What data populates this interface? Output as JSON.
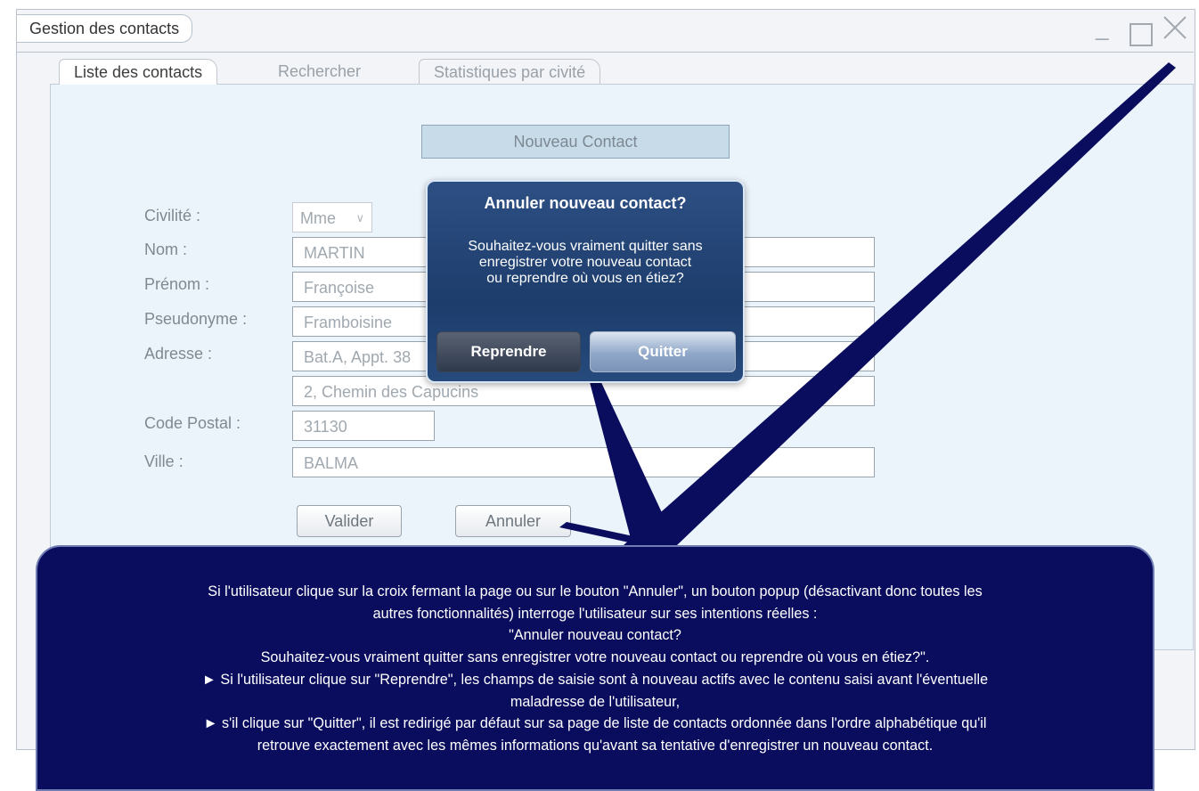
{
  "window": {
    "title": "Gestion des contacts",
    "controls": [
      "minimize-icon",
      "maximize-icon",
      "close-icon"
    ]
  },
  "tabs": [
    {
      "label": "Liste des contacts",
      "active": true
    },
    {
      "label": "Rechercher",
      "active": false
    },
    {
      "label": "Statistiques par civité",
      "active": false
    }
  ],
  "form": {
    "new_contact_button": "Nouveau Contact",
    "labels": {
      "civilite": "Civilité :",
      "nom": "Nom :",
      "prenom": "Prénom :",
      "pseudonyme": "Pseudonyme :",
      "adresse": "Adresse :",
      "code_postal": "Code Postal :",
      "ville": "Ville :"
    },
    "values": {
      "civilite": "Mme",
      "nom": "MARTIN",
      "prenom": "Françoise",
      "pseudonyme": "Framboisine",
      "adresse1": "Bat.A, Appt. 38",
      "adresse2": "2, Chemin des Capucins",
      "code_postal": "31130",
      "ville": "BALMA"
    },
    "valider_label": "Valider",
    "annuler_label": "Annuler"
  },
  "dialog": {
    "title": "Annuler nouveau contact?",
    "message_lines": [
      "Souhaitez-vous vraiment quitter sans",
      "enregistrer votre nouveau contact",
      "ou reprendre où vous en étiez?"
    ],
    "reprendre_label": "Reprendre",
    "quitter_label": "Quitter"
  },
  "callout": {
    "lines": [
      "Si l'utilisateur clique sur la croix fermant la page ou sur le bouton \"Annuler\", un bouton popup (désactivant donc toutes les",
      "autres fonctionnalités) interroge l'utilisateur sur ses intentions réelles :",
      "\"Annuler nouveau contact?",
      "Souhaitez-vous vraiment quitter sans enregistrer votre nouveau contact ou reprendre où vous en étiez?\".",
      "► Si l'utilisateur clique sur \"Reprendre\", les champs de saisie sont à nouveau actifs avec le contenu saisi avant l'éventuelle",
      "maladresse de l'utilisateur,",
      "► s'il clique sur \"Quitter\", il est redirigé par défaut sur sa page de liste de contacts ordonnée dans l'ordre alphabétique qu'il",
      "retrouve exactement avec les mêmes informations qu'avant sa tentative d'enregistrer un nouveau contact."
    ]
  },
  "colors": {
    "callout_bg": "#0a0d5e",
    "dialog_bg": "#1d3d6c",
    "panel_bg": "#ecf4fb"
  }
}
